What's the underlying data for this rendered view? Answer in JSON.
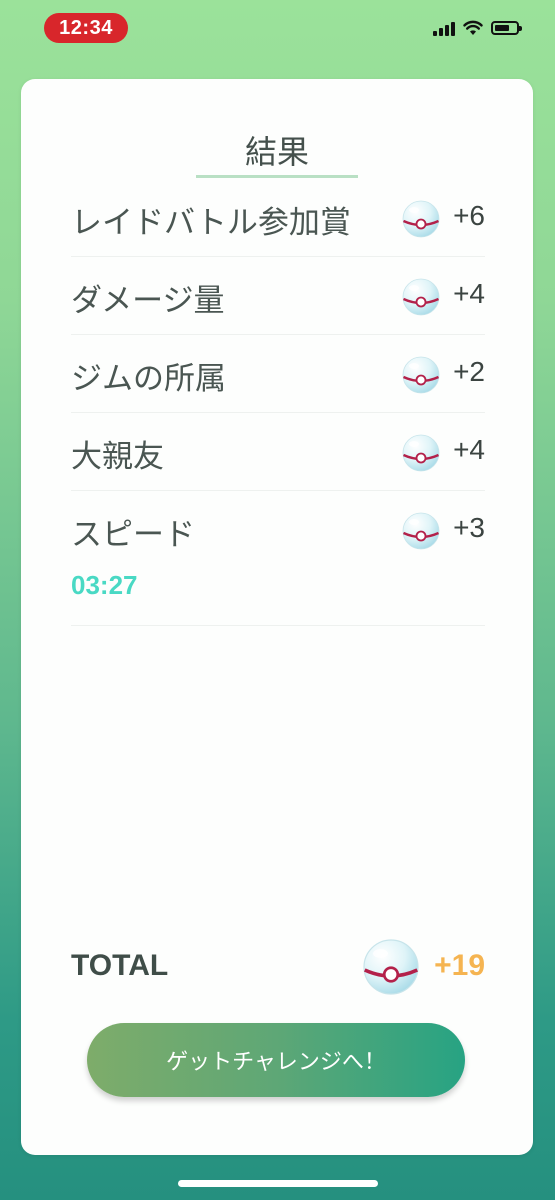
{
  "status_bar": {
    "time": "12:34",
    "icons": [
      "signal-icon",
      "wifi-icon",
      "battery-icon"
    ]
  },
  "card": {
    "title": "結果",
    "rows": [
      {
        "label": "レイドバトル参加賞",
        "value": "+6",
        "icon": "premier-ball-icon"
      },
      {
        "label": "ダメージ量",
        "value": "+4",
        "icon": "premier-ball-icon"
      },
      {
        "label": "ジムの所属",
        "value": "+2",
        "icon": "premier-ball-icon"
      },
      {
        "label": "大親友",
        "value": "+4",
        "icon": "premier-ball-icon"
      },
      {
        "label": "スピード",
        "value": "+3",
        "time": "03:27",
        "icon": "premier-ball-icon"
      }
    ],
    "total": {
      "label": "TOTAL",
      "value": "+19",
      "icon": "premier-ball-icon"
    },
    "cta_label": "ゲットチャレンジへ！"
  },
  "colors": {
    "time_pill": "#d8262b",
    "speed_time": "#49d9c4",
    "total_value": "#f5b451",
    "accent_green": "#27a383"
  }
}
